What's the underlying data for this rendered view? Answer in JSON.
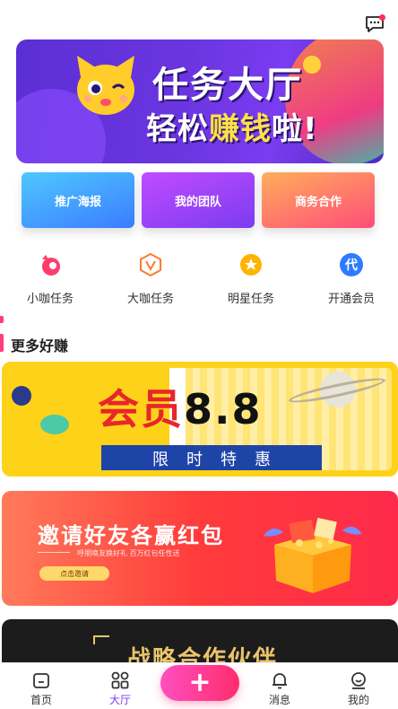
{
  "header": {
    "message_icon": "message-icon"
  },
  "hero": {
    "line1": "任务大厅",
    "line2_a": "轻松",
    "line2_b": "赚钱",
    "line2_c": "啦!",
    "mascot_icon": "cat-mascot-icon"
  },
  "quick_actions": [
    {
      "label": "推广海报"
    },
    {
      "label": "我的团队"
    },
    {
      "label": "商务合作"
    }
  ],
  "tasks": [
    {
      "label": "小咖任务",
      "icon": "small-task-icon",
      "color": "#ff3d6d"
    },
    {
      "label": "大咖任务",
      "icon": "v-badge-icon",
      "color": "#ff7a2d"
    },
    {
      "label": "明星任务",
      "icon": "star-icon",
      "color": "#ffb300"
    },
    {
      "label": "开通会员",
      "icon": "vip-icon",
      "color": "#2f7bff"
    }
  ],
  "section": {
    "title": "更多好赚"
  },
  "banners": {
    "member": {
      "a": "会员",
      "b": "8.8",
      "band": "限时特惠"
    },
    "invite": {
      "title": "邀请好友各赢红包",
      "subtitle": "呼朋唤友换好礼 百万红包任性送",
      "button": "点击邀请"
    },
    "partner": {
      "title": "战略合作伙伴"
    }
  },
  "tabbar": {
    "items": [
      {
        "label": "首页",
        "icon": "home-icon"
      },
      {
        "label": "大厅",
        "icon": "grid-icon",
        "active": true
      },
      {
        "label": "消息",
        "icon": "bell-icon"
      },
      {
        "label": "我的",
        "icon": "profile-icon"
      }
    ],
    "plus_label": "+"
  },
  "colors": {
    "accent": "#7b3cf0",
    "pink": "#ff2d6d"
  }
}
